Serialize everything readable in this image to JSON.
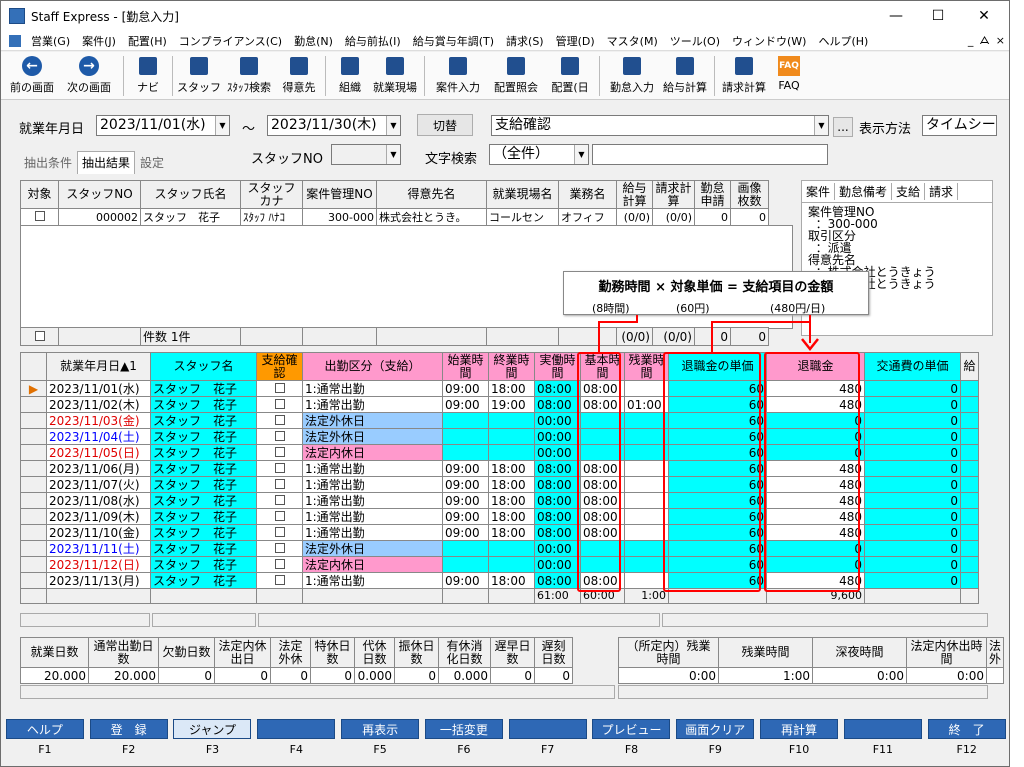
{
  "window": {
    "title": "Staff Express - [勤怠入力]",
    "minimize": "—",
    "maximize": "☐",
    "close": "✕"
  },
  "menu": [
    "営業(G)",
    "案件(J)",
    "配置(H)",
    "コンプライアンス(C)",
    "勤怠(N)",
    "給与前払(I)",
    "給与賞与年調(T)",
    "請求(S)",
    "管理(D)",
    "マスタ(M)",
    "ツール(O)",
    "ウィンドウ(W)",
    "ヘルプ(H)"
  ],
  "menu_right": [
    "_",
    "ᗋ",
    "×"
  ],
  "toolbar": [
    "前の画面",
    "次の画面",
    "ナビ",
    "スタッフ",
    "ｽﾀｯﾌ検索",
    "得意先",
    "組織",
    "就業現場",
    "案件入力",
    "配置照会",
    "配置(日",
    "勤怠入力",
    "給与計算",
    "請求計算",
    "FAQ"
  ],
  "filter": {
    "period_label": "就業年月日",
    "from": "2023/11/01(水)",
    "tilde": "〜",
    "to": "2023/11/30(木)",
    "switch": "切替",
    "mode": "支給確認",
    "more": "...",
    "display_label": "表示方法",
    "display_value": "タイムシー",
    "staff_label": "スタッフNO",
    "search_label": "文字検索",
    "search_value": "（全件）"
  },
  "tabs": [
    "抽出条件",
    "抽出結果",
    "設定"
  ],
  "top_grid": {
    "headers": [
      "対象",
      "スタッフNO",
      "スタッフ氏名",
      "スタッフカナ",
      "案件管理NO",
      "得意先名",
      "就業現場名",
      "業務名",
      "給与計算",
      "請求計算",
      "勤怠申請",
      "画像枚数"
    ],
    "row": [
      "",
      "000002",
      "スタッフ　花子",
      "ｽﾀｯﾌ ﾊﾅｺ",
      "300-000",
      "株式会社とうき。",
      "コールセン",
      "オフィフ",
      "(0/0)",
      "(0/0)",
      "0",
      "0"
    ],
    "summary": {
      "count": "件数 1件",
      "pay": "(0/0)",
      "bill": "(0/0)",
      "req": "0",
      "img": "0"
    }
  },
  "panel": {
    "tabs": [
      "案件",
      "勤怠備考",
      "支給",
      "請求"
    ],
    "text": "案件管理NO\n  ：300-000\n取引区分\n  ：派遣\n得意先名\n  ：株式会社とうきょう\n  ：株式会社とうきょう"
  },
  "callout": {
    "title": "勤務時間 × 対象単価 = 支給項目の金額",
    "sub1": "(8時間)",
    "sub2": "(60円)",
    "sub3": "(480円/日)"
  },
  "grid": {
    "headers": [
      "就業年月日▲1",
      "スタッフ名",
      "支給確認",
      "出勤区分（支給）",
      "始業時間",
      "終業時間",
      "実働時間",
      "基本時間",
      "残業時間",
      "退職金の単価",
      "退職金",
      "交通費の単価",
      "給"
    ],
    "rows": [
      {
        "date": "2023/11/01(水)",
        "dc": "",
        "staff": "スタッフ　花子",
        "kbn": "1:通常出勤",
        "kc": "wh",
        "start": "09:00",
        "end": "18:00",
        "work": "08:00",
        "basic": "08:00",
        "ot": "",
        "unit": "60",
        "amt": "480",
        "tr": "0"
      },
      {
        "date": "2023/11/02(木)",
        "dc": "",
        "staff": "スタッフ　花子",
        "kbn": "1:通常出勤",
        "kc": "wh",
        "start": "09:00",
        "end": "19:00",
        "work": "08:00",
        "basic": "08:00",
        "ot": "01:00",
        "unit": "60",
        "amt": "480",
        "tr": "0"
      },
      {
        "date": "2023/11/03(金)",
        "dc": "red",
        "staff": "スタッフ　花子",
        "kbn": "法定外休日",
        "kc": "bl",
        "start": "",
        "end": "",
        "work": "00:00",
        "basic": "",
        "ot": "",
        "unit": "60",
        "amt": "0",
        "tr": "0"
      },
      {
        "date": "2023/11/04(土)",
        "dc": "blu",
        "staff": "スタッフ　花子",
        "kbn": "法定外休日",
        "kc": "bl",
        "start": "",
        "end": "",
        "work": "00:00",
        "basic": "",
        "ot": "",
        "unit": "60",
        "amt": "0",
        "tr": "0"
      },
      {
        "date": "2023/11/05(日)",
        "dc": "red",
        "staff": "スタッフ　花子",
        "kbn": "法定内休日",
        "kc": "pk",
        "start": "",
        "end": "",
        "work": "00:00",
        "basic": "",
        "ot": "",
        "unit": "60",
        "amt": "0",
        "tr": "0"
      },
      {
        "date": "2023/11/06(月)",
        "dc": "",
        "staff": "スタッフ　花子",
        "kbn": "1:通常出勤",
        "kc": "wh",
        "start": "09:00",
        "end": "18:00",
        "work": "08:00",
        "basic": "08:00",
        "ot": "",
        "unit": "60",
        "amt": "480",
        "tr": "0"
      },
      {
        "date": "2023/11/07(火)",
        "dc": "",
        "staff": "スタッフ　花子",
        "kbn": "1:通常出勤",
        "kc": "wh",
        "start": "09:00",
        "end": "18:00",
        "work": "08:00",
        "basic": "08:00",
        "ot": "",
        "unit": "60",
        "amt": "480",
        "tr": "0"
      },
      {
        "date": "2023/11/08(水)",
        "dc": "",
        "staff": "スタッフ　花子",
        "kbn": "1:通常出勤",
        "kc": "wh",
        "start": "09:00",
        "end": "18:00",
        "work": "08:00",
        "basic": "08:00",
        "ot": "",
        "unit": "60",
        "amt": "480",
        "tr": "0"
      },
      {
        "date": "2023/11/09(木)",
        "dc": "",
        "staff": "スタッフ　花子",
        "kbn": "1:通常出勤",
        "kc": "wh",
        "start": "09:00",
        "end": "18:00",
        "work": "08:00",
        "basic": "08:00",
        "ot": "",
        "unit": "60",
        "amt": "480",
        "tr": "0"
      },
      {
        "date": "2023/11/10(金)",
        "dc": "",
        "staff": "スタッフ　花子",
        "kbn": "1:通常出勤",
        "kc": "wh",
        "start": "09:00",
        "end": "18:00",
        "work": "08:00",
        "basic": "08:00",
        "ot": "",
        "unit": "60",
        "amt": "480",
        "tr": "0"
      },
      {
        "date": "2023/11/11(土)",
        "dc": "blu",
        "staff": "スタッフ　花子",
        "kbn": "法定外休日",
        "kc": "bl",
        "start": "",
        "end": "",
        "work": "00:00",
        "basic": "",
        "ot": "",
        "unit": "60",
        "amt": "0",
        "tr": "0"
      },
      {
        "date": "2023/11/12(日)",
        "dc": "red",
        "staff": "スタッフ　花子",
        "kbn": "法定内休日",
        "kc": "pk",
        "start": "",
        "end": "",
        "work": "00:00",
        "basic": "",
        "ot": "",
        "unit": "60",
        "amt": "0",
        "tr": "0"
      },
      {
        "date": "2023/11/13(月)",
        "dc": "",
        "staff": "スタッフ　花子",
        "kbn": "1:通常出勤",
        "kc": "wh",
        "start": "09:00",
        "end": "18:00",
        "work": "08:00",
        "basic": "08:00",
        "ot": "",
        "unit": "60",
        "amt": "480",
        "tr": "0"
      }
    ],
    "totals": {
      "work": "61:00",
      "basic": "60:00",
      "ot": "1:00",
      "amt": "9,600"
    }
  },
  "bottom": {
    "left_headers": [
      "就業日数",
      "通常出勤日数",
      "欠勤日数",
      "法定内休出日",
      "法定外休",
      "特休日数",
      "代休日数",
      "振休日数",
      "有休消化日数",
      "遅早日数",
      "遅刻日数"
    ],
    "left_values": [
      "20.000",
      "20.000",
      "0",
      "0",
      "0",
      "0",
      "0.000",
      "0",
      "0.000",
      "0",
      "0"
    ],
    "right_headers": [
      "（所定内）残業時間",
      "残業時間",
      "深夜時間",
      "法定内休出時間",
      "法外"
    ],
    "right_values": [
      "0:00",
      "1:00",
      "0:00",
      "0:00",
      ""
    ]
  },
  "fkeys": [
    [
      "ヘルプ",
      "F1"
    ],
    [
      "登　録",
      "F2"
    ],
    [
      "ジャンプ",
      "F3"
    ],
    [
      "",
      "F4"
    ],
    [
      "再表示",
      "F5"
    ],
    [
      "一括変更",
      "F6"
    ],
    [
      "",
      "F7"
    ],
    [
      "プレビュー",
      "F8"
    ],
    [
      "画面クリア",
      "F9"
    ],
    [
      "再計算",
      "F10"
    ],
    [
      "",
      "F11"
    ],
    [
      "終　了",
      "F12"
    ]
  ],
  "colors": {
    "cyan": "#00ffff",
    "pink": "#ff99cc",
    "blue": "#99ccff",
    "fkey": "#2e68b5",
    "highlight": "#ff0000"
  }
}
